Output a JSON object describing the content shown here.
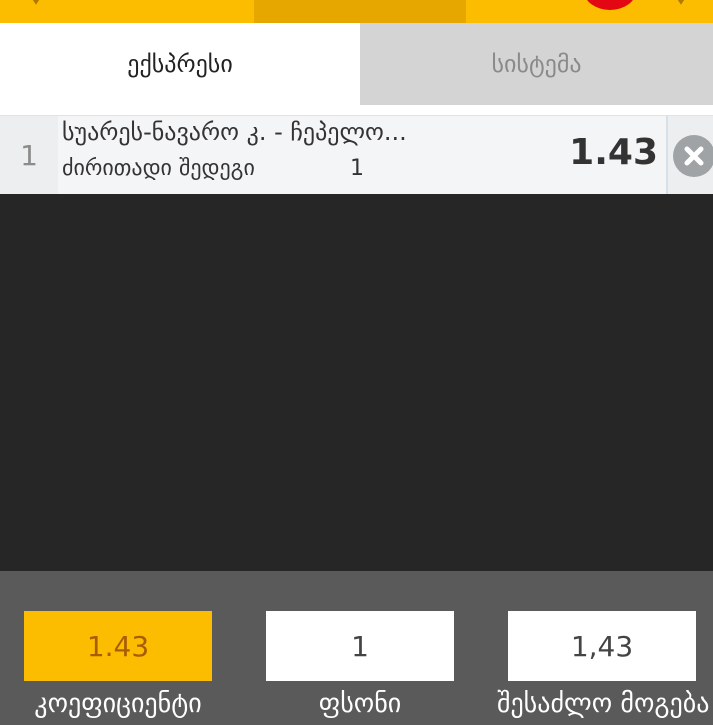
{
  "tabs": [
    {
      "label": "ექსპრესი",
      "active": true
    },
    {
      "label": "სისტემა",
      "active": false
    }
  ],
  "bet": {
    "index": "1",
    "match": "სუარეს-ნავარო კ. - ჩეპელო...",
    "market": "ძირითადი შედეგი",
    "outcome": "1",
    "odds": "1.43"
  },
  "summary": {
    "coefficient_value": "1.43",
    "coefficient_label": "კოეფიციენტი",
    "stake_value": "1",
    "stake_label": "ფსონი",
    "win_value": "1,43",
    "win_label": "შესაძლო მოგება"
  },
  "colors": {
    "accent": "#fcbd00",
    "accent_text": "#a85e00",
    "badge": "#e30613",
    "background": "#262626",
    "panel": "#5a5a5a"
  },
  "icons": {
    "remove": "close-icon",
    "top_left": "chevron-down-icon",
    "top_right": "chevron-down-icon"
  }
}
